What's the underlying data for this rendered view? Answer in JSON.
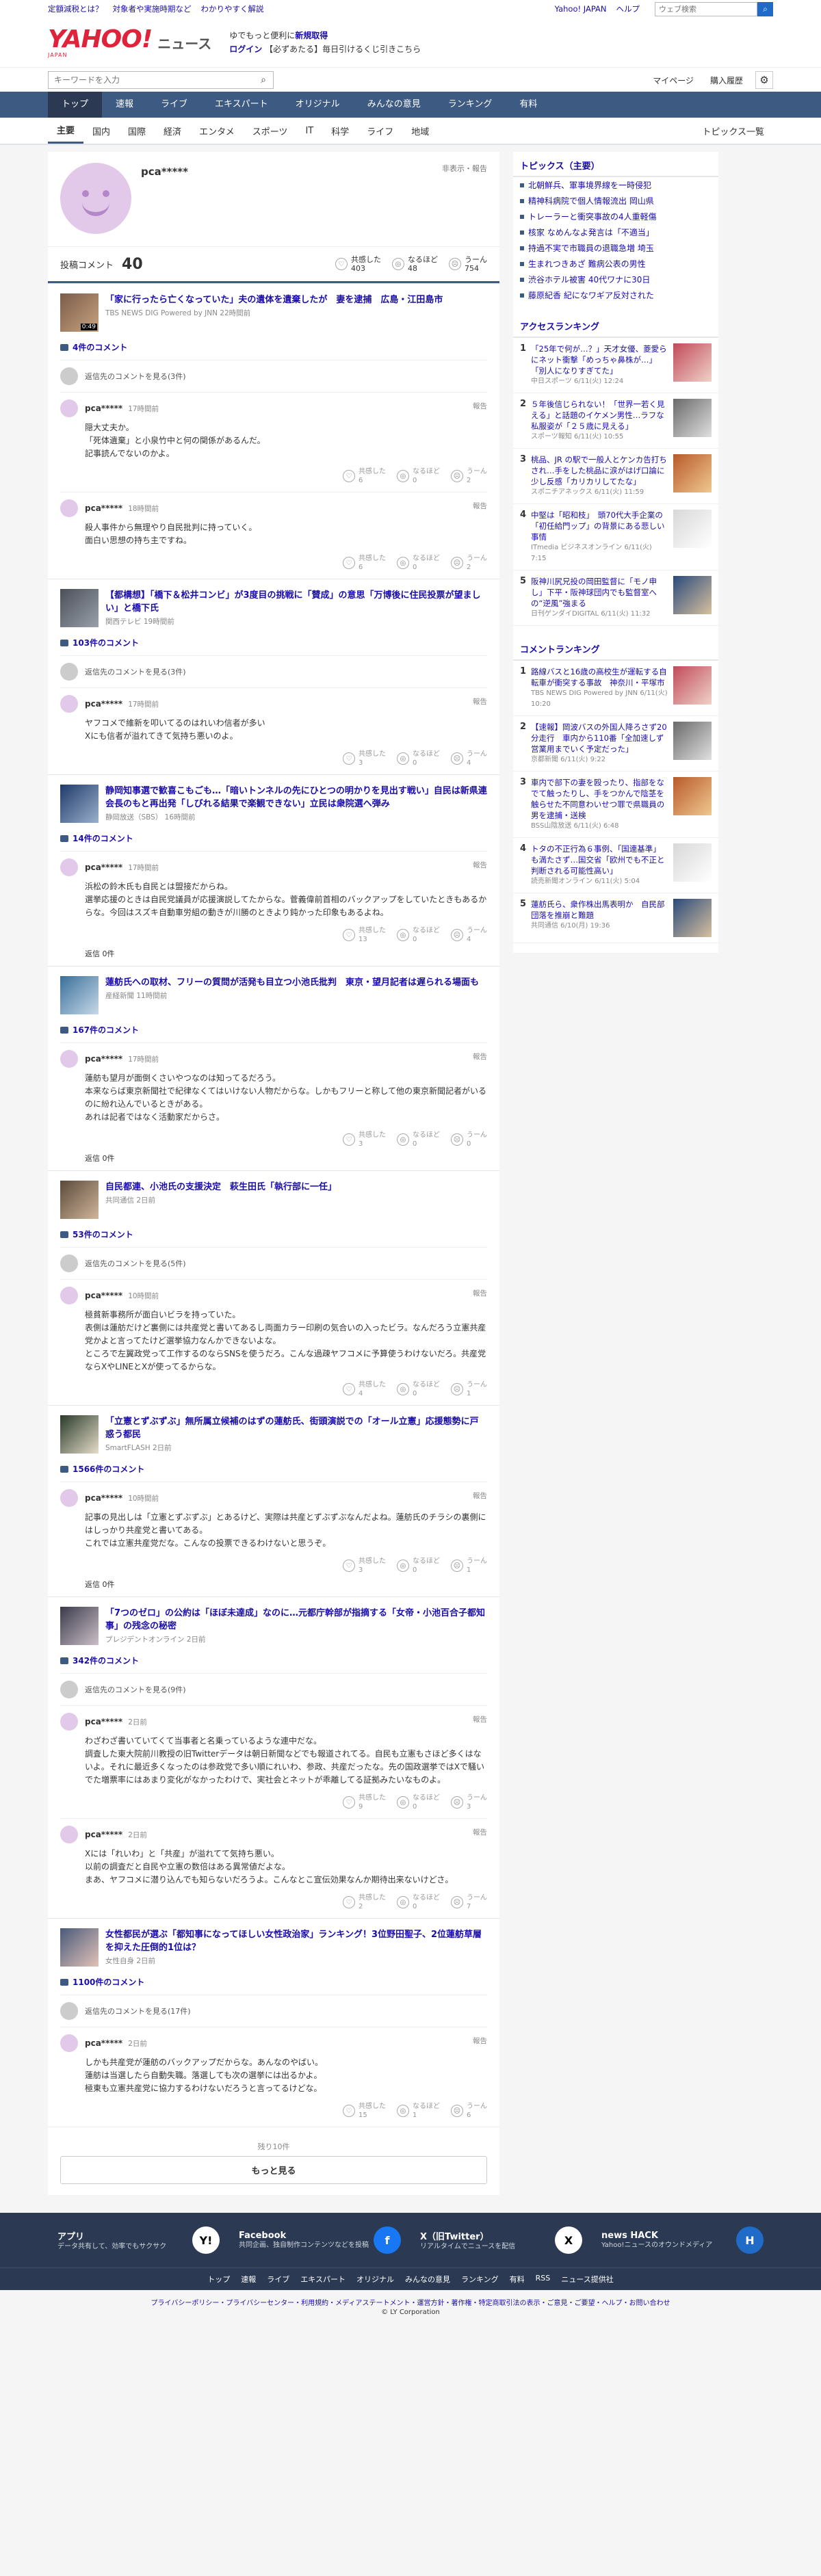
{
  "topbar": {
    "links": [
      "定額減税とは？",
      "対象者や実施時期など",
      "わかりやすく解説"
    ],
    "right": [
      "Yahoo! JAPAN",
      "ヘルプ"
    ],
    "search_placeholder": "ウェブ検索"
  },
  "header": {
    "logo": "YAHOO!",
    "logo_sub": "JAPAN",
    "news": "ニュース",
    "promo_line1_a": "ゆでもっと便利に",
    "promo_line1_b": "新規取得",
    "promo_line2_a": "ログイン",
    "promo_line2_b": "【必ずあたる】毎日引けるくじ引きこちら"
  },
  "search": {
    "placeholder": "キーワードを入力",
    "links": [
      "マイページ",
      "購入履歴"
    ]
  },
  "nav": {
    "tabs": [
      "トップ",
      "速報",
      "ライブ",
      "エキスパート",
      "オリジナル",
      "みんなの意見",
      "ランキング",
      "有料"
    ]
  },
  "subnav": {
    "items": [
      "主要",
      "国内",
      "国際",
      "経済",
      "エンタメ",
      "スポーツ",
      "IT",
      "科学",
      "ライフ",
      "地域"
    ],
    "topics": "トピックス一覧"
  },
  "profile": {
    "name": "pca*****",
    "violation": "非表示・報告",
    "label": "投稿コメント",
    "count": "40",
    "rx": [
      {
        "label": "共感した",
        "n": "403"
      },
      {
        "label": "なるほど",
        "n": "48"
      },
      {
        "label": "うーん",
        "n": "754"
      }
    ]
  },
  "reactions": [
    "共感した",
    "なるほど",
    "うーん"
  ],
  "articles": [
    {
      "title": "「家に行ったら亡くなっていた」夫の遺体を遺棄したが　妻を逮捕　広島・江田島市",
      "source": "TBS NEWS DIG Powered by JNN 22時間前",
      "dur": "0:49",
      "count": "4件のコメント",
      "others": "返信先のコメントを見る(3件)",
      "comments": [
        {
          "name": "pca*****",
          "time": "17時間前",
          "body": "隠大丈夫か。\n「死体遺棄」と小泉竹中と何の関係があるんだ。\n記事読んでないのかよ。",
          "rx": [
            "6",
            "0",
            "2"
          ]
        },
        {
          "name": "pca*****",
          "time": "18時間前",
          "body": "殺人事件から無理やり自民批判に持っていく。\n面白い思想の持ち主ですね。",
          "rx": [
            "6",
            "0",
            "2"
          ]
        }
      ]
    },
    {
      "title": "【都構想】「橋下＆松井コンビ」が3度目の挑戦に「賛成」の意思「万博後に住民投票が望ましい」と橋下氏",
      "source": "関西テレビ 19時間前",
      "count": "103件のコメント",
      "others": "返信先のコメントを見る(3件)",
      "comments": [
        {
          "name": "pca*****",
          "time": "17時間前",
          "body": "ヤフコメで維新を叩いてるのはれいわ信者が多い\nXにも信者が溢れてきて気持ち悪いのよ。",
          "rx": [
            "3",
            "0",
            "4"
          ]
        }
      ]
    },
    {
      "title": "静岡知事選で歓喜こもごも…「暗いトンネルの先にひとつの明かりを見出す戦い」自民は新県連会長のもと再出発「しびれる結果で楽観できない」立民は衆院選へ弾み",
      "source": "静岡放送（SBS） 16時間前",
      "count": "14件のコメント",
      "comments": [
        {
          "name": "pca*****",
          "time": "17時間前",
          "body": "浜松の鈴木氏も自民とは盟接だからね。\n選挙応援のときは自民党議員が応援演説してたからな。菅義偉前首相のバックアップをしていたときもあるからな。今回はスズキ自動車労組の動きが川勝のときより鈍かった印象もあるよね。",
          "rx": [
            "13",
            "0",
            "4"
          ],
          "reply": "返信 0件"
        }
      ]
    },
    {
      "title": "蓮舫氏への取材、フリーの質問が活発も目立つ小池氏批判　東京・望月記者は遅られる場面も",
      "source": "産経新聞 11時間前",
      "count": "167件のコメント",
      "comments": [
        {
          "name": "pca*****",
          "time": "17時間前",
          "body": "蓮舫も望月が面倒くさいやつなのは知ってるだろう。\n本来ならば東京新聞社で紀律なくてはいけない人物だからな。しかもフリーと称して他の東京新聞記者がいるのに紛れ込んでいるときがある。\nあれは記者ではなく活動家だからさ。",
          "rx": [
            "3",
            "0",
            "0"
          ],
          "reply": "返信 0件"
        }
      ]
    },
    {
      "title": "自民都連、小池氏の支援決定　萩生田氏「執行部に一任」",
      "source": "共同通信 2日前",
      "count": "53件のコメント",
      "others": "返信先のコメントを見る(5件)",
      "comments": [
        {
          "name": "pca*****",
          "time": "10時間前",
          "body": "極貧新事務所が面白いビラを持っていた。\n表側は蓮舫だけど裏側には共産党と書いてあるし両面カラー印刷の気合いの入ったビラ。なんだろう立憲共産党かよと言ってたけど選挙協力なんかできないよな。\nところで左翼政党って工作するのならSNSを使うだろ。こんな過疎ヤフコメに予算使うわけないだろ。共産党ならXやLINEとXが使ってるからな。",
          "rx": [
            "4",
            "0",
            "1"
          ]
        }
      ]
    },
    {
      "title": "「立憲とずぶずぶ」無所属立候補のはずの蓮舫氏、街頭演説での「オール立憲」応援態勢に戸惑う都民",
      "source": "SmartFLASH 2日前",
      "count": "1566件のコメント",
      "comments": [
        {
          "name": "pca*****",
          "time": "10時間前",
          "body": "記事の見出しは「立憲とずぶずぶ」とあるけど、実際は共産とずぶずぶなんだよね。蓮舫氏のチラシの裏側にはしっかり共産党と書いてある。\nこれでは立憲共産党だな。こんなの投票できるわけないと思うぞ。",
          "rx": [
            "3",
            "0",
            "1"
          ],
          "reply": "返信 0件"
        }
      ]
    },
    {
      "title": "「7つのゼロ」の公約は「ほぼ未達成」なのに…元都庁幹部が指摘する「女帝・小池百合子都知事」の残念の秘密",
      "source": "プレジデントオンライン 2日前",
      "count": "342件のコメント",
      "others": "返信先のコメントを見る(9件)",
      "comments": [
        {
          "name": "pca*****",
          "time": "2日前",
          "body": "わざわざ書いていてくて当事者と名乗っているような連中だな。\n調査した東大院前川教授の旧Twitterデータは朝日新聞などでも報道されてる。自民も立憲もさほど多くはないよ。それに最近多くなったのは参政党で多い順にれいわ、参政、共産だったな。先の国政選挙ではXで騒いでた増票率にはあまり変化がなかったわけで、実社会とネットが乖離してる証拠みたいなものよ。",
          "rx": [
            "9",
            "0",
            "3"
          ]
        },
        {
          "name": "pca*****",
          "time": "2日前",
          "body": "Xには「れいわ」と「共産」が溢れてて気持ち悪い。\n以前の調査だと自民や立憲の数倍はある異常値だよな。\nまあ、ヤフコメに潜り込んでも知らないだろうよ。こんなとこ宣伝効果なんか期待出来ないけどさ。",
          "rx": [
            "2",
            "0",
            "7"
          ]
        }
      ]
    },
    {
      "title": "女性都民が選ぶ「都知事になってほしい女性政治家」ランキング！3位野田聖子、2位蓮舫草層を抑えた圧倒的1位は？",
      "source": "女性自身 2日前",
      "count": "1100件のコメント",
      "others": "返信先のコメントを見る(17件)",
      "comments": [
        {
          "name": "pca*****",
          "time": "2日前",
          "body": "しかも共産党が蓮舫のバックアップだからな。あんなのやばい。\n蓮舫は当選したら自動失職。落選しても次の選挙には出るかよ。\n極東も立憲共産党に協力するわけないだろうと言ってるけどな。",
          "rx": [
            "15",
            "1",
            "6"
          ]
        }
      ]
    }
  ],
  "more": {
    "rest": "残り10件",
    "button": "もっと見る"
  },
  "side": {
    "topics_title": "トピックス（主要）",
    "topics": [
      "北朝鮮兵、軍事境界線を一時侵犯",
      "精神科病院で個人情報流出 岡山県",
      "トレーラーと衝突事故の4人重軽傷",
      "核家 なめんなよ発言は「不適当」",
      "持過不実で市職員の退職急増 埼玉",
      "生まれつきあざ 難病公表の男性",
      "渋谷ホテル被害 40代ワナに30日",
      "藤原紀香 紀になワギア反対された"
    ],
    "access_title": "アクセスランキング",
    "access": [
      {
        "text": "「25年で何が…？」天才女優、菱愛らにネット衝撃「めっちゃ鼻株が…」「別人になりすぎてた」",
        "src": "中日スポーツ 6/11(火) 12:24"
      },
      {
        "text": "５年後信じられない！「世界一若く見える」と話題のイケメン男性…ラフな私服姿が「２５歳に見える」",
        "src": "スポーツ報知 6/11(火) 10:55"
      },
      {
        "text": "桃品、JR の駅で一般人とケンカ告打ちされ…手をした桃品に涙がはげ口論に 少し反感「カリカリしてたな」",
        "src": "スポニチアネックス 6/11(火) 11:59"
      },
      {
        "text": "中堅は「昭和枝」　頭70代大手企業の「初任給門ップ」の背景にある悲しい事情",
        "src": "ITmedia ビジネスオンライン 6/11(火) 7:15"
      },
      {
        "text": "阪神川尻兄投の岡田監督に「モノ申し」下平・阪神球団内でも監督室への“逆風”強まる",
        "src": "日刊ゲンダイDIGITAL 6/11(火) 11:32"
      }
    ],
    "comment_title": "コメントランキング",
    "comment": [
      {
        "text": "路線バスと16歳の高校生が運転する自転車が衝突する事故　神奈川・平塚市",
        "src": "TBS NEWS DIG Powered by JNN 6/11(火) 10:20"
      },
      {
        "text": "【速報】岡波バスの外国人降ろさず20分走行　車内から110番「全加速しず営業用までいく予定だった」",
        "src": "京都新聞 6/11(火) 9:22"
      },
      {
        "text": "車内で部下の妻を殴ったり、指部をなでて触ったりし、手をつかんで陰茎を触らせた不同意わいせつ罪で県職員の男を逮捕・送検",
        "src": "BSS山陰放送 6/11(火) 6:48"
      },
      {
        "text": "トタの不正行為６事例、「国連基準」も満たさず…国交省「欧州でも不正と判断される可能性高い」",
        "src": "読売新聞オンライン 6/11(火) 5:04"
      },
      {
        "text": "蓮舫氏ら、衆作株出馬表明か　自民部団落を推崩と難題",
        "src": "共同通信 6/10(月) 19:36"
      }
    ]
  },
  "footer": {
    "items": [
      {
        "title": "アプリ",
        "desc": "データ共有して、効率でもサクサク",
        "icon": "Y!"
      },
      {
        "title": "Facebook",
        "desc": "共同企画、独自制作コンテンツなどを投稿",
        "icon": "f"
      },
      {
        "title": "X（旧Twitter）",
        "desc": "リアルタイムでニュースを配信",
        "icon": "X"
      },
      {
        "title": "news HACK",
        "desc": "Yahoo!ニュースのオウンドメディア",
        "icon": "H"
      }
    ],
    "links": [
      "トップ",
      "速報",
      "ライブ",
      "エキスパート",
      "オリジナル",
      "みんなの意見",
      "ランキング",
      "有料",
      "RSS",
      "ニュース提供社"
    ],
    "bottom": "プライバシーポリシー・プライバシーセンター・利用規約・メディアステートメント・運営方針・著作権・特定商取引法の表示・ご意見・ご要望・ヘルプ・お問い合わせ",
    "copy": "© LY Corporation"
  },
  "colors": {
    "nav": "#3c5a82",
    "link": "#1a0dab",
    "brand": "#e0223a",
    "avatar": "#e3c9e9"
  }
}
